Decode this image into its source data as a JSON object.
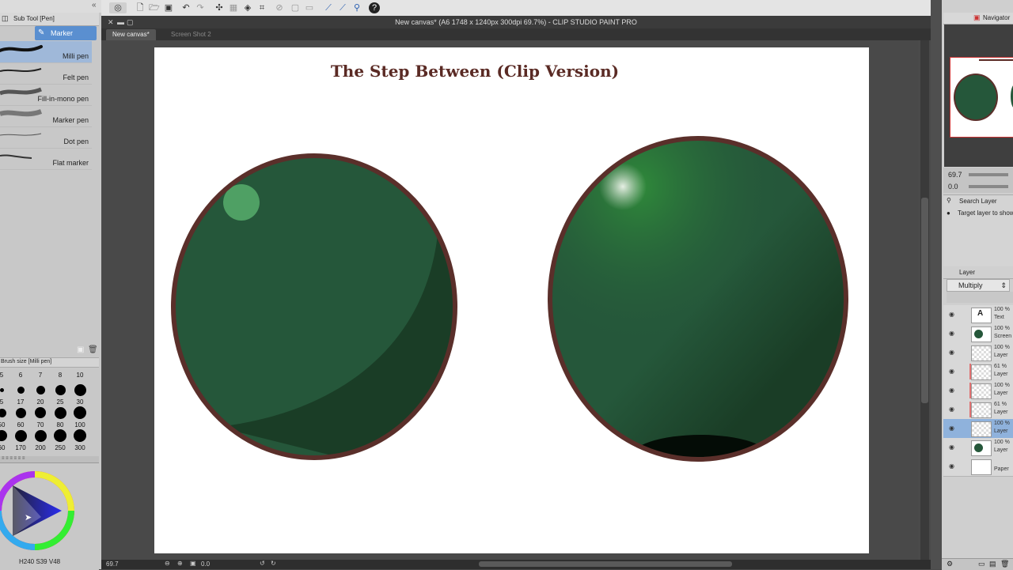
{
  "app": {
    "window_title": "New canvas* (A6 1748 x 1240px 300dpi 69.7%) - CLIP STUDIO PAINT PRO"
  },
  "tabs": [
    {
      "label": "New canvas*",
      "active": true
    },
    {
      "label": "Screen Shot 2",
      "active": false
    }
  ],
  "sub_tool": {
    "panel_title": "Sub Tool [Pen]",
    "group_tab": "Marker",
    "brushes": [
      {
        "label": "Milli pen",
        "selected": true
      },
      {
        "label": "Felt pen",
        "selected": false
      },
      {
        "label": "Fill-in-mono pen",
        "selected": false
      },
      {
        "label": "Marker pen",
        "selected": false
      },
      {
        "label": "Dot pen",
        "selected": false
      },
      {
        "label": "Flat marker",
        "selected": false
      }
    ]
  },
  "brush_size": {
    "panel_title": "Brush size [Milli pen]",
    "rows": [
      [
        "5",
        "6",
        "7",
        "8",
        "10"
      ],
      [
        "5",
        "17",
        "20",
        "25",
        "30"
      ],
      [
        "50",
        "60",
        "70",
        "80",
        "100"
      ],
      [
        "60",
        "170",
        "200",
        "250",
        "300"
      ]
    ]
  },
  "color": {
    "hue": "240",
    "saturation": "39",
    "value": "48",
    "label_h": "H",
    "label_s": "S",
    "label_v": "V"
  },
  "canvas": {
    "heading": "The Step Between (Clip Version)",
    "zoom": "69.7",
    "rotation": "0.0",
    "colors": {
      "sphere_base": "#25573a",
      "sphere_shadow": "#1a3d26",
      "outline": "#5a2f2a",
      "highlight_left": "#4fa064",
      "highlight_right": "#d9e6d6"
    }
  },
  "navigator": {
    "panel_title": "Navigator",
    "zoom_value": "69.7",
    "rotation_value": "0.0"
  },
  "layer_search": {
    "label": "Search Layer",
    "hint": "Target layer to show"
  },
  "layers": {
    "panel_title": "Layer",
    "blend_mode": "Multiply",
    "items": [
      {
        "opacity": "100 %",
        "name": "Text",
        "thumb": "text",
        "selected": false,
        "red": false
      },
      {
        "opacity": "100 %",
        "name": "Screen Shot",
        "thumb": "sphere",
        "selected": false,
        "red": false
      },
      {
        "opacity": "100 %",
        "name": "Layer",
        "thumb": "blank",
        "selected": false,
        "red": false
      },
      {
        "opacity": "61 %",
        "name": "Layer",
        "thumb": "blank",
        "selected": false,
        "red": true
      },
      {
        "opacity": "100 %",
        "name": "Layer",
        "thumb": "blank",
        "selected": false,
        "red": true
      },
      {
        "opacity": "61 %",
        "name": "Layer",
        "thumb": "blank",
        "selected": false,
        "red": true
      },
      {
        "opacity": "100 %",
        "name": "Layer",
        "thumb": "blank",
        "selected": true,
        "red": false
      },
      {
        "opacity": "100 %",
        "name": "Layer",
        "thumb": "sphere",
        "selected": false,
        "red": false
      },
      {
        "opacity": "",
        "name": "Paper",
        "thumb": "paper",
        "selected": false,
        "red": false
      }
    ]
  }
}
